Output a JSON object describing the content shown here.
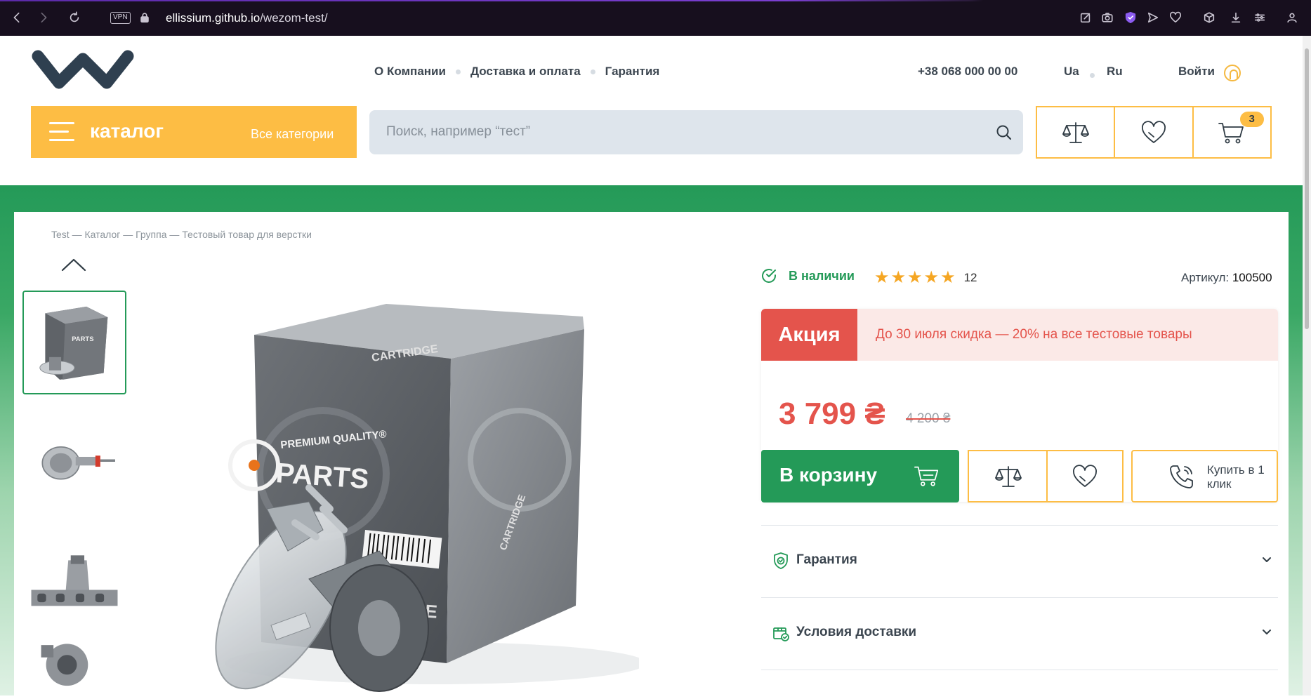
{
  "browser": {
    "url_host": "ellissium.github.io",
    "url_path": "/wezom-test/",
    "vpn_label": "VPN",
    "accent_color": "#6a35c2"
  },
  "header": {
    "nav": [
      "О Компании",
      "Доставка и оплата",
      "Гарантия"
    ],
    "phone": "+38 068 000 00 00",
    "langs": [
      "Ua",
      "Ru"
    ],
    "login": "Войти",
    "logo_color": "#2f4050"
  },
  "catalog": {
    "title": "каталог",
    "all_categories": "Все категории",
    "color": "#fdbd44"
  },
  "search": {
    "placeholder": "Поиск, например “тест”"
  },
  "actions": {
    "cart_count": "3",
    "icons": [
      "compare-icon",
      "heart-icon",
      "cart-icon"
    ]
  },
  "breadcrumb": "Test — Каталог — Группа — Тестовый товар для верстки",
  "product": {
    "stock": "В наличии",
    "rating": 5,
    "stars": "★★★★★",
    "reviews": "12",
    "sku_label": "Артикул:",
    "sku_value": "100500",
    "promo_tag": "Акция",
    "promo_text": "До 30 июля скидка — 20% на все тестовые товары",
    "price": "3 799 ₴",
    "old_price": "4 200 ₴",
    "to_cart": "В корзину",
    "one_click": "Купить в 1 клик",
    "accent_green": "#249a58",
    "accent_red": "#e4544c"
  },
  "accordion": [
    {
      "label": "Гарантия",
      "icon": "shield-icon"
    },
    {
      "label": "Условия доставки",
      "icon": "delivery-icon"
    }
  ],
  "images": {
    "box_text": [
      "PREMIUM QUALITY®",
      "PARTS",
      "CARTRIDGE",
      "RIDGE"
    ]
  }
}
